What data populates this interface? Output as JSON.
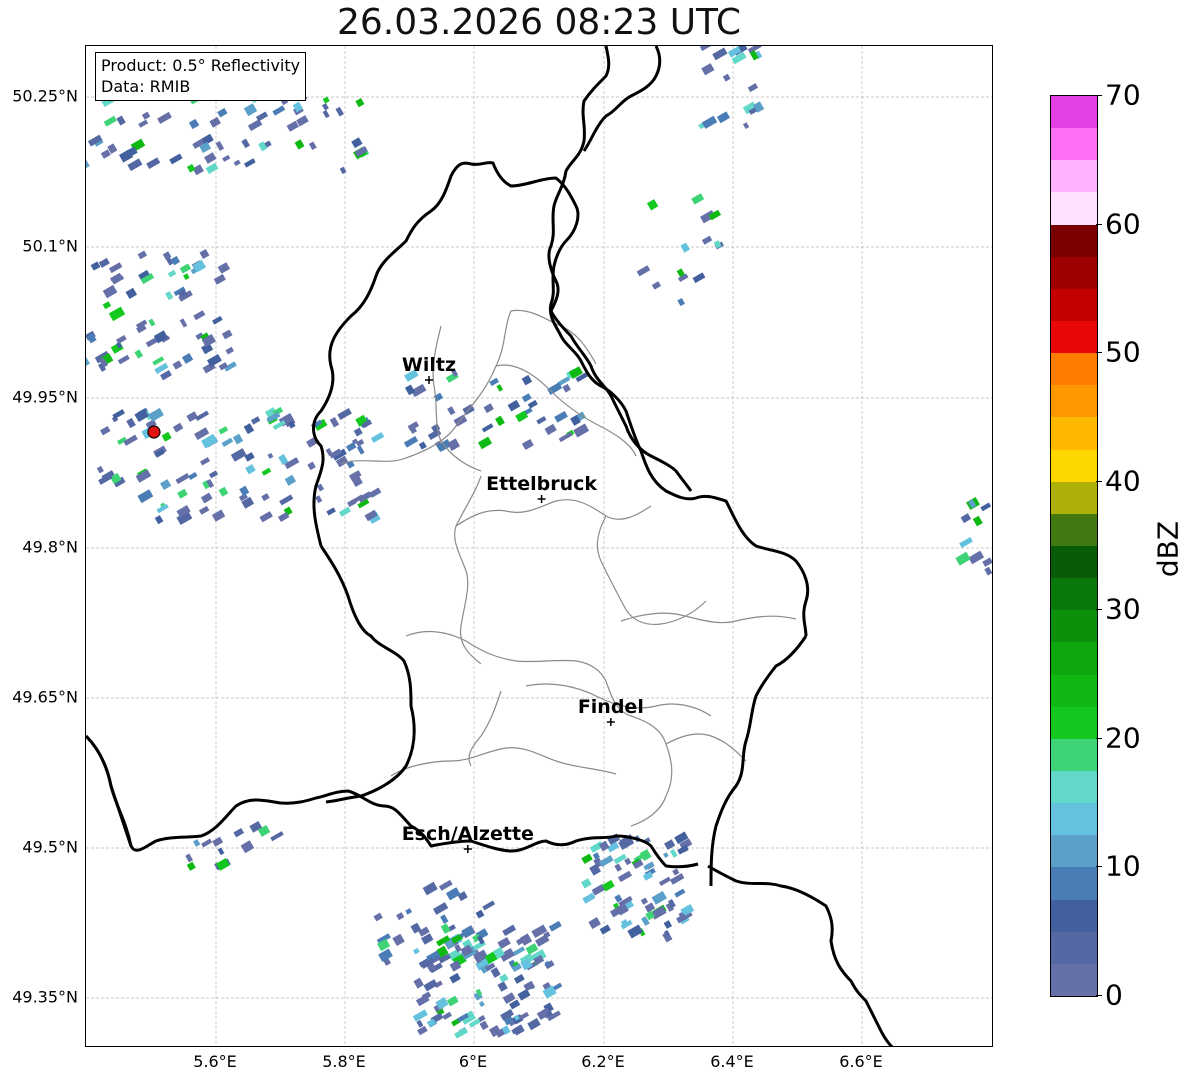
{
  "title": "26.03.2026 08:23 UTC",
  "info": {
    "product": "Product: 0.5° Reflectivity",
    "data_source": "Data: RMIB"
  },
  "cities": [
    {
      "name": "Wiltz",
      "lon": 5.93,
      "lat": 49.966
    },
    {
      "name": "Ettelbruck",
      "lon": 6.104,
      "lat": 49.847
    },
    {
      "name": "Findel",
      "lon": 6.211,
      "lat": 49.624
    },
    {
      "name": "Esch/Alzette",
      "lon": 5.99,
      "lat": 49.497
    }
  ],
  "radar_site": {
    "lon": 5.505,
    "lat": 49.914
  },
  "axes": {
    "x_ticks": [
      "5.6°E",
      "5.8°E",
      "6°E",
      "6.2°E",
      "6.4°E",
      "6.6°E"
    ],
    "y_ticks": [
      "50.25°N",
      "50.1°N",
      "49.95°N",
      "49.8°N",
      "49.65°N",
      "49.5°N",
      "49.35°N"
    ]
  },
  "colorbar": {
    "title": "dBZ",
    "ticks": [
      "0",
      "10",
      "20",
      "30",
      "40",
      "50",
      "60",
      "70"
    ],
    "colors": [
      "#6670a8",
      "#5468a4",
      "#42609e",
      "#4a7db6",
      "#5aa0c8",
      "#64c2de",
      "#62d8c8",
      "#3ed476",
      "#14c820",
      "#10b814",
      "#0ea80e",
      "#0c900c",
      "#0a780a",
      "#085c08",
      "#427810",
      "#aeb00a",
      "#ffd700",
      "#ffb800",
      "#ff9800",
      "#ff7c00",
      "#e80808",
      "#c20000",
      "#9e0000",
      "#7a0000",
      "#ffe0ff",
      "#ffb2ff",
      "#ff70f4",
      "#e43ee6"
    ]
  },
  "chart_data": {
    "type": "map",
    "extent": {
      "lon_min": 5.4,
      "lon_max": 6.8,
      "lat_min": 49.3,
      "lat_max": 50.3
    },
    "grid": true,
    "projection": "plate-carree",
    "colorbar_range": [
      0,
      70
    ],
    "colorbar_step": 2.5
  }
}
